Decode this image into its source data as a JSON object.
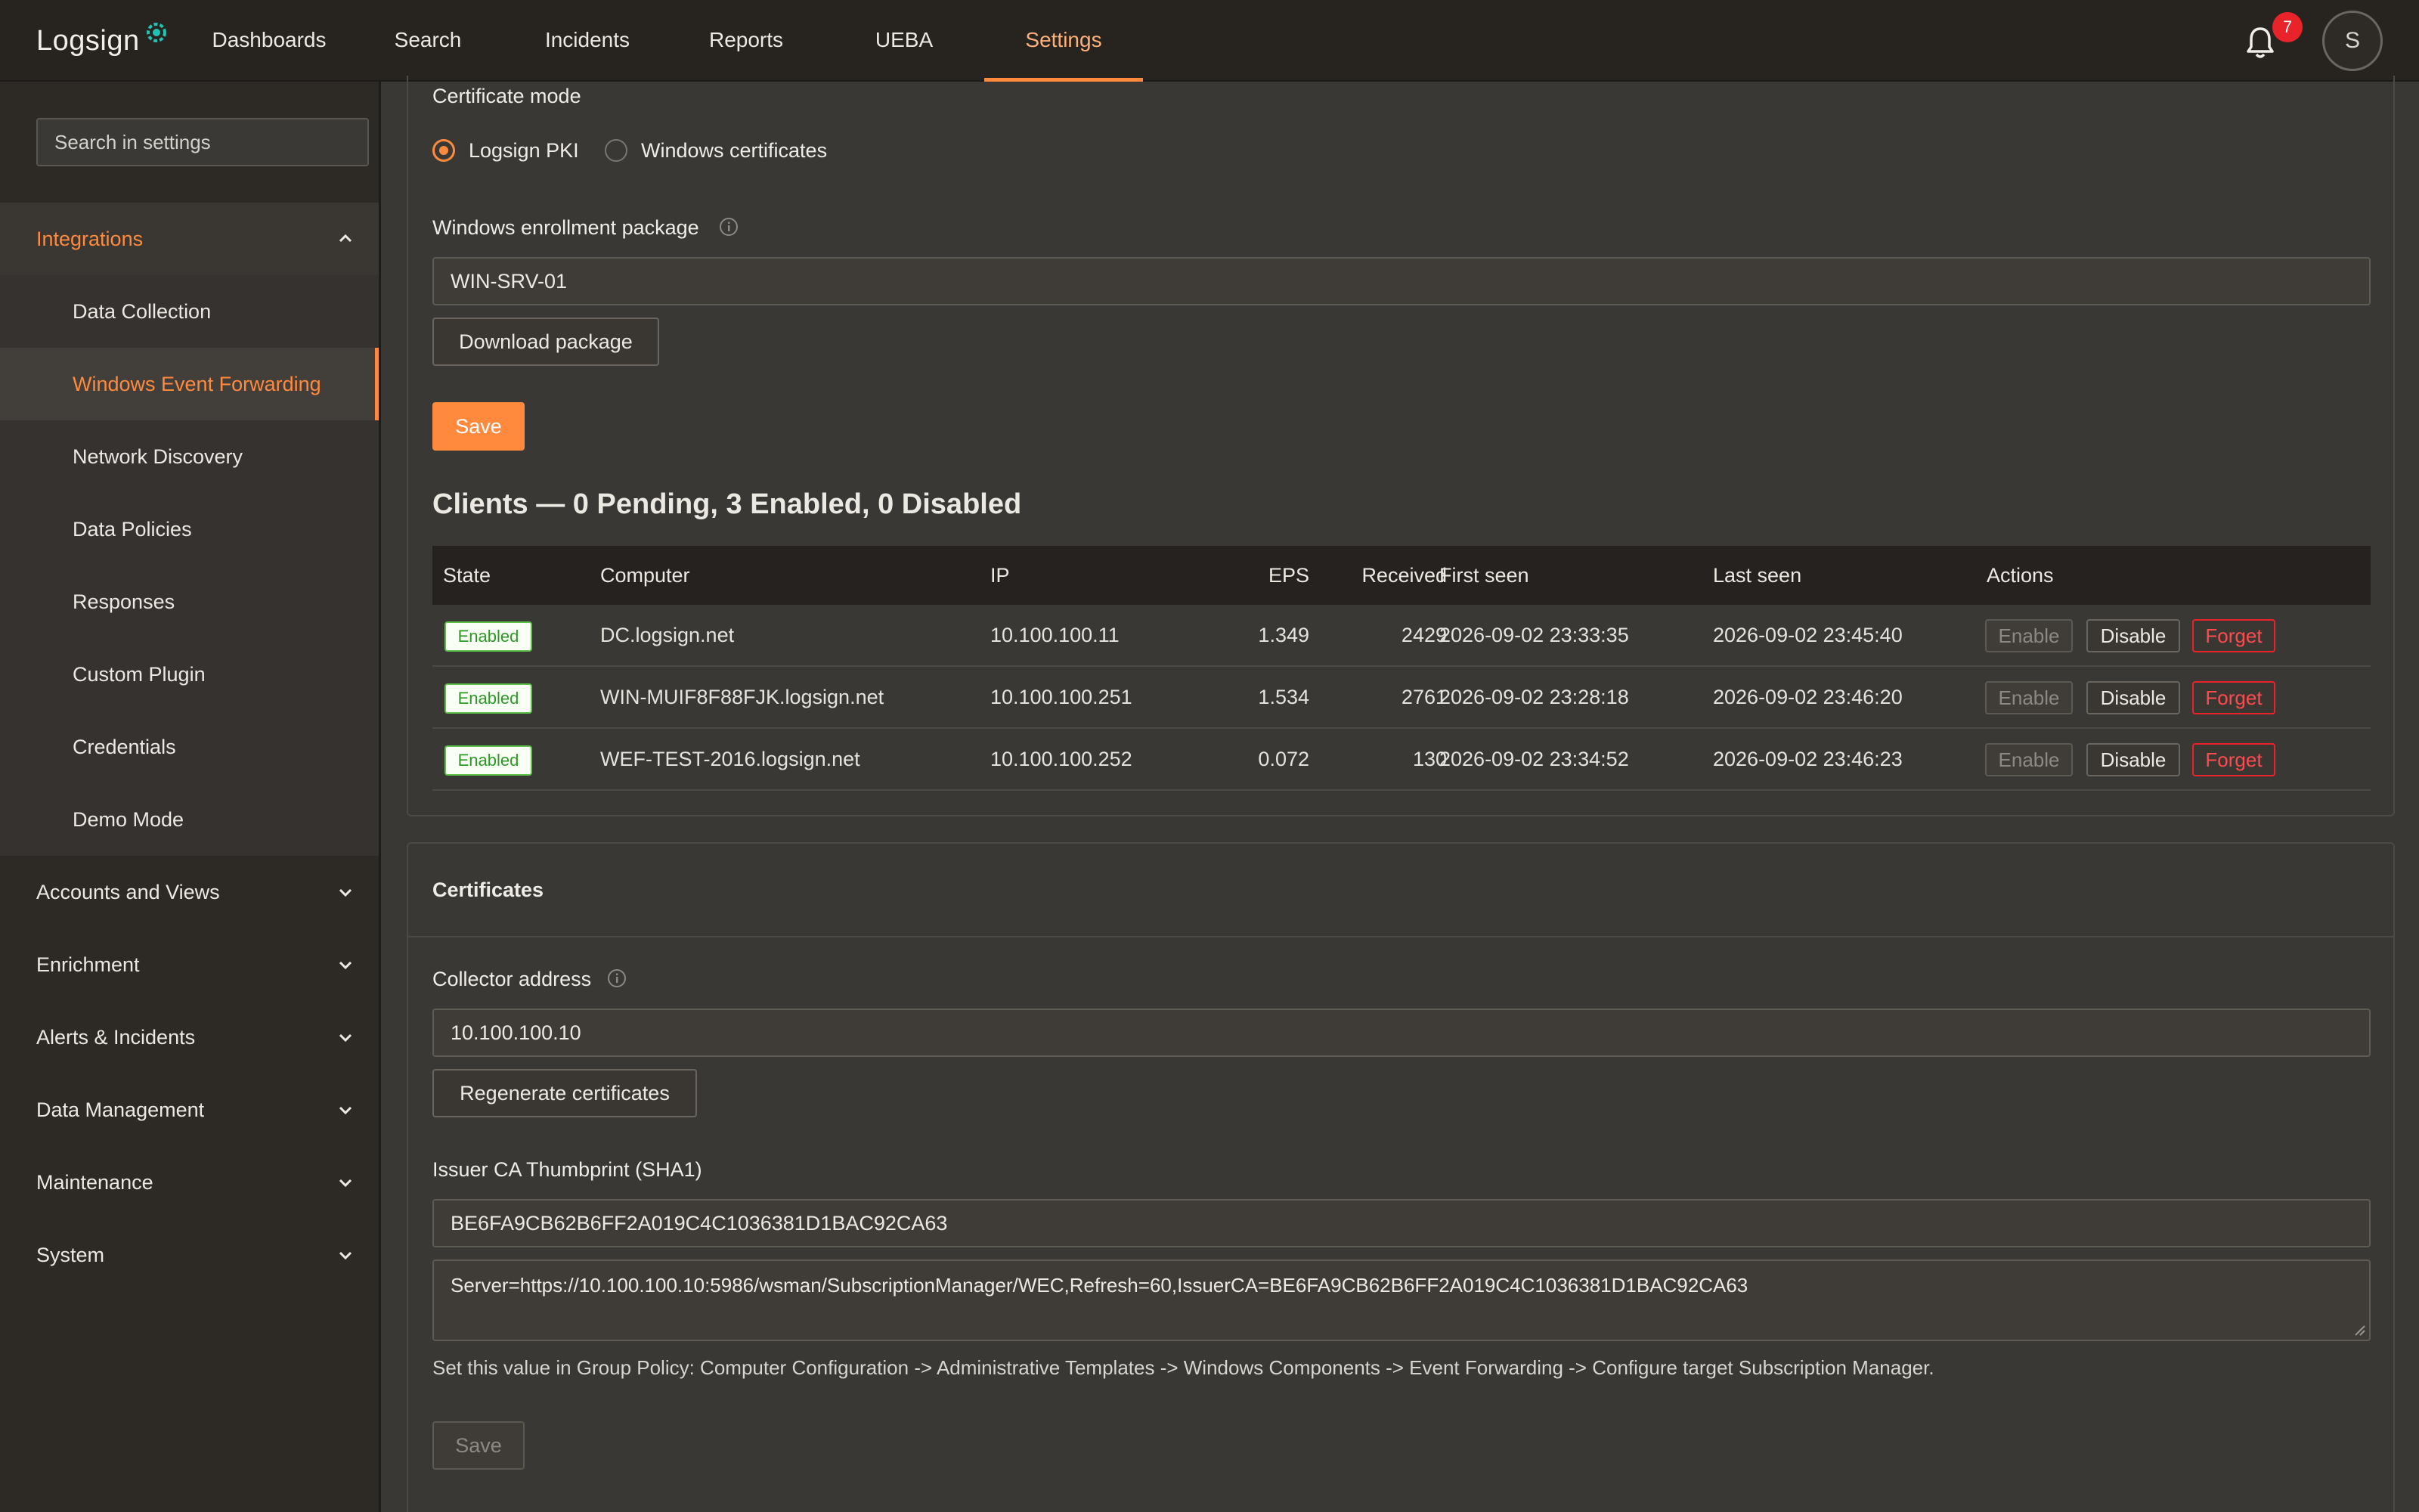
{
  "app": {
    "logo_text": "Logsign"
  },
  "nav": {
    "items": [
      "Dashboards",
      "Search",
      "Incidents",
      "Reports",
      "UEBA",
      "Settings"
    ],
    "active": "Settings",
    "notification_count": "7",
    "avatar_initial": "S"
  },
  "sidebar": {
    "search_placeholder": "Search in settings",
    "open_section": "Integrations",
    "sub_items": [
      "Data Collection",
      "Windows Event Forwarding",
      "Network Discovery",
      "Data Policies",
      "Responses",
      "Custom Plugin",
      "Credentials",
      "Demo Mode"
    ],
    "active_sub_item": "Windows Event Forwarding",
    "sections": [
      "Accounts and Views",
      "Enrichment",
      "Alerts & Incidents",
      "Data Management",
      "Maintenance",
      "System"
    ]
  },
  "wef": {
    "cert_mode_label": "Certificate mode",
    "cert_mode_options": [
      "Logsign PKI",
      "Windows certificates"
    ],
    "cert_mode_selected": "Logsign PKI",
    "enrollment_label": "Windows enrollment package",
    "enrollment_value": "WIN-SRV-01",
    "download_label": "Download package",
    "save_label": "Save"
  },
  "clients": {
    "heading": "Clients — 0 Pending, 3 Enabled, 0 Disabled",
    "columns": [
      "State",
      "Computer",
      "IP",
      "EPS",
      "Received",
      "First seen",
      "Last seen",
      "Actions"
    ],
    "rows": [
      {
        "state": "Enabled",
        "computer": "DC.logsign.net",
        "ip": "10.100.100.11",
        "eps": "1.349",
        "received": "2429",
        "first_seen": "2026-09-02 23:33:35",
        "last_seen": "2026-09-02 23:45:40"
      },
      {
        "state": "Enabled",
        "computer": "WIN-MUIF8F88FJK.logsign.net",
        "ip": "10.100.100.251",
        "eps": "1.534",
        "received": "2761",
        "first_seen": "2026-09-02 23:28:18",
        "last_seen": "2026-09-02 23:46:20"
      },
      {
        "state": "Enabled",
        "computer": "WEF-TEST-2016.logsign.net",
        "ip": "10.100.100.252",
        "eps": "0.072",
        "received": "130",
        "first_seen": "2026-09-02 23:34:52",
        "last_seen": "2026-09-02 23:46:23"
      }
    ],
    "actions": [
      "Enable",
      "Disable",
      "Forget"
    ]
  },
  "certificates": {
    "title": "Certificates",
    "collector_label": "Collector address",
    "collector_value": "10.100.100.10",
    "regenerate_label": "Regenerate certificates",
    "thumbprint_label": "Issuer CA Thumbprint (SHA1)",
    "thumbprint_value": "BE6FA9CB62B6FF2A019C4C1036381D1BAC92CA63",
    "subscription_value": "Server=https://10.100.100.10:5986/wsman/SubscriptionManager/WEC,Refresh=60,IssuerCA=BE6FA9CB62B6FF2A019C4C1036381D1BAC92CA63",
    "note": "Set this value in Group Policy: Computer Configuration -> Administrative Templates -> Windows Components -> Event Forwarding -> Configure target Subscription Manager.",
    "save_label": "Save"
  },
  "colors": {
    "accent": "#ff8a3d",
    "danger": "#e8242a",
    "success": "#5cc24a"
  }
}
